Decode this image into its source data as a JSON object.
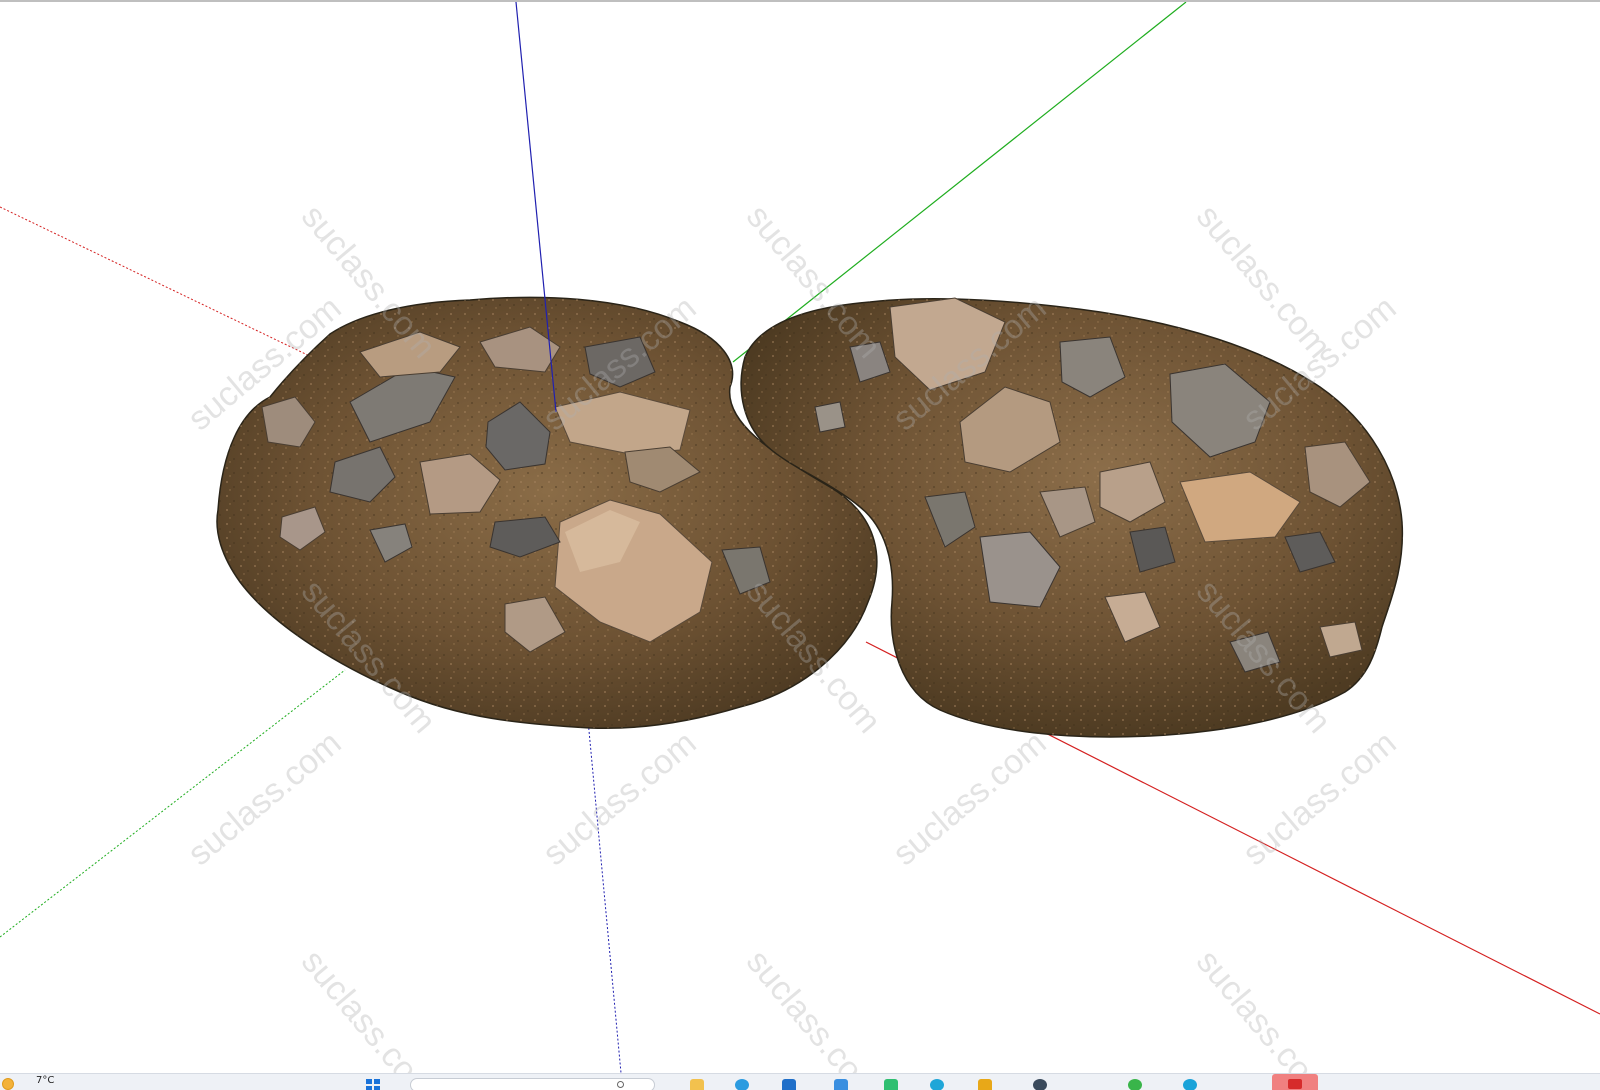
{
  "viewport": {
    "model_name": "rock mound terrain",
    "watermark_text": "suclass.com",
    "axes": {
      "red": "#d42020",
      "green": "#1fad1f",
      "blue": "#2020b0"
    },
    "colors": {
      "soil_dark": "#5a4428",
      "soil_mid": "#7a5e3c",
      "soil_light": "#9a7a52",
      "rock_light": "#b8a48e",
      "rock_dark": "#6a6460",
      "rock_tan": "#c9a27e",
      "outline": "#2a2418"
    }
  },
  "taskbar": {
    "temperature": "7°C",
    "icons": [
      "weather-icon",
      "start-icon",
      "search-icon",
      "file-explorer-icon",
      "browser-icon",
      "store-icon",
      "mail-icon",
      "chat-icon",
      "edge-icon",
      "folder-icon",
      "settings-icon",
      "app-icon",
      "app-icon",
      "sketchup-icon"
    ]
  }
}
